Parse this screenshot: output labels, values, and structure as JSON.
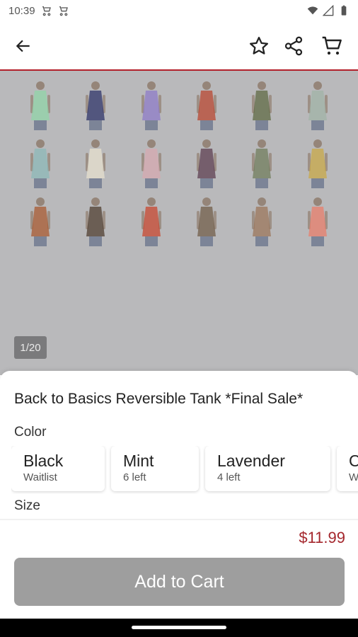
{
  "status_bar": {
    "time": "10:39",
    "icons": [
      "cart-notification-icon",
      "cart-notification-icon",
      "wifi-icon",
      "signal-icon",
      "battery-icon"
    ]
  },
  "app_bar": {
    "icons": [
      "back-arrow-icon",
      "star-icon",
      "share-icon",
      "cart-icon"
    ]
  },
  "gallery": {
    "counter": "1/20",
    "thumbnails": [
      "#8fd6a8",
      "#2a2f66",
      "#8c79c9",
      "#b8432d",
      "#5c6640",
      "#9fb3a6",
      "#8ab8b8",
      "#e8e1cf",
      "#d7a8b0",
      "#5a3a4d",
      "#6d7a59",
      "#c9a844",
      "#a8562c",
      "#4c3a2c",
      "#c8432b",
      "#6f5a45",
      "#9a7358",
      "#ea7b68"
    ]
  },
  "product": {
    "title": "Back to Basics Reversible Tank *Final Sale*",
    "color_label": "Color",
    "colors": [
      {
        "name": "Black",
        "stock": "Waitlist"
      },
      {
        "name": "Mint",
        "stock": "6 left"
      },
      {
        "name": "Lavender",
        "stock": "4 left"
      },
      {
        "name": "C",
        "stock": "W"
      }
    ],
    "size_label": "Size",
    "price": "$11.99",
    "add_to_cart": "Add to Cart"
  },
  "colors": {
    "accent": "#b3202a",
    "price": "#a4262c",
    "button_disabled": "#9e9e9e",
    "overlay": "#b9b9bb"
  }
}
